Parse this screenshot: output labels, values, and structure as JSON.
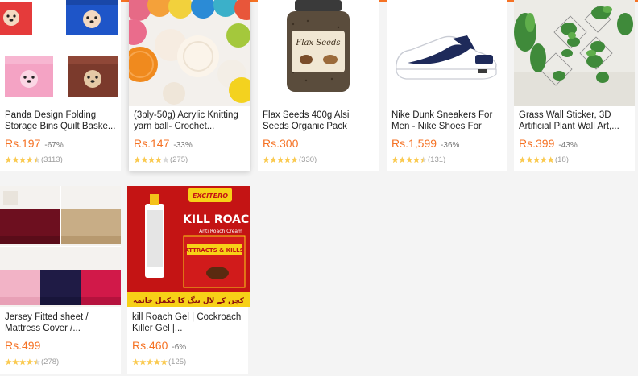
{
  "products": [
    {
      "title": "Panda Design Folding Storage Bins Quilt Baske...",
      "price": "Rs.197",
      "discount": "-67%",
      "rating": 4.5,
      "reviews": "(3113)",
      "image": "storage-bins-image"
    },
    {
      "title": "(3ply-50g) Acrylic Knitting yarn ball- Crochet...",
      "price": "Rs.147",
      "discount": "-33%",
      "rating": 4.0,
      "reviews": "(275)",
      "image": "yarn-balls-image"
    },
    {
      "title": "Flax Seeds 400g Alsi Seeds Organic Pack",
      "price": "Rs.300",
      "discount": "",
      "rating": 5.0,
      "reviews": "(330)",
      "image": "flax-seeds-jar-image",
      "jar_label": "Flax Seeds"
    },
    {
      "title": "Nike Dunk Sneakers For Men - Nike Shoes For Me...",
      "price": "Rs.1,599",
      "discount": "-36%",
      "rating": 4.5,
      "reviews": "(131)",
      "image": "sneaker-image"
    },
    {
      "title": "Grass Wall Sticker, 3D Artificial Plant Wall Art,...",
      "price": "Rs.399",
      "discount": "-43%",
      "rating": 5.0,
      "reviews": "(18)",
      "image": "plant-wall-image"
    },
    {
      "title": "Jersey Fitted sheet / Mattress Cover /...",
      "price": "Rs.499",
      "discount": "",
      "rating": 4.5,
      "reviews": "(278)",
      "image": "fitted-sheets-image"
    },
    {
      "title": "kill Roach Gel | Cockroach Killer Gel |...",
      "price": "Rs.460",
      "discount": "-6%",
      "rating": 5.0,
      "reviews": "(125)",
      "image": "kill-roach-image",
      "brand": "EXCITERO",
      "product_name": "KILL ROACH",
      "subtitle": "Anti Roach Cream",
      "box_banner": "ATTRACTS & KILLS",
      "urdu_text": "کچن کے لال بیگ کا مکمل خاتمہ"
    }
  ],
  "colors": {
    "accent": "#f57224",
    "star": "#faca51"
  }
}
